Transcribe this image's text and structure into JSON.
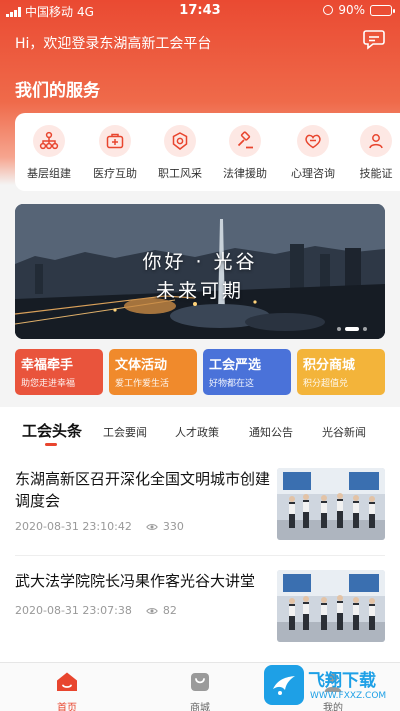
{
  "status_bar": {
    "carrier": "中国移动",
    "network": "4G",
    "time": "17:43",
    "battery": "90%",
    "battery_level": 0.9
  },
  "header": {
    "welcome": "Hi，欢迎登录东湖高新工会平台",
    "message_icon": "chat-bubble-icon"
  },
  "services": {
    "title": "我们的服务",
    "items": [
      {
        "label": "基层组建",
        "icon": "org-tree-icon"
      },
      {
        "label": "医疗互助",
        "icon": "medical-kit-icon"
      },
      {
        "label": "职工风采",
        "icon": "badge-icon"
      },
      {
        "label": "法律援助",
        "icon": "gavel-icon"
      },
      {
        "label": "心理咨询",
        "icon": "heart-icon"
      },
      {
        "label": "技能证",
        "icon": "person-icon"
      }
    ]
  },
  "banner": {
    "line1": "你好 · 光谷",
    "line2": "未来可期",
    "slide_count": 3,
    "active_slide": 2
  },
  "feature_cards": [
    {
      "title": "幸福牵手",
      "subtitle": "助您走进幸福",
      "color": "#e9543c"
    },
    {
      "title": "文体活动",
      "subtitle": "爱工作爱生活",
      "color": "#f08a2c"
    },
    {
      "title": "工会严选",
      "subtitle": "好物都在这",
      "color": "#4a72d9"
    },
    {
      "title": "积分商城",
      "subtitle": "积分超值兑",
      "color": "#f3b43a"
    }
  ],
  "news_tabs": [
    {
      "label": "工会头条",
      "active": true
    },
    {
      "label": "工会要闻",
      "active": false
    },
    {
      "label": "人才政策",
      "active": false
    },
    {
      "label": "通知公告",
      "active": false
    },
    {
      "label": "光谷新闻",
      "active": false
    }
  ],
  "news": [
    {
      "title": "东湖高新区召开深化全国文明城市创建调度会",
      "date": "2020-08-31 23:10:42",
      "views": "330"
    },
    {
      "title": "武大法学院院长冯果作客光谷大讲堂",
      "date": "2020-08-31 23:07:38",
      "views": "82"
    }
  ],
  "bottom_nav": [
    {
      "label": "首页",
      "icon": "home-icon",
      "active": true
    },
    {
      "label": "商城",
      "icon": "shop-bag-icon",
      "active": false
    },
    {
      "label": "我的",
      "icon": "user-icon",
      "active": false
    }
  ],
  "watermark": {
    "brand": "飞翔下载",
    "url": "WWW.FXXZ.COM"
  },
  "colors": {
    "accent": "#e8452e",
    "header_top": "#ea4a32"
  }
}
